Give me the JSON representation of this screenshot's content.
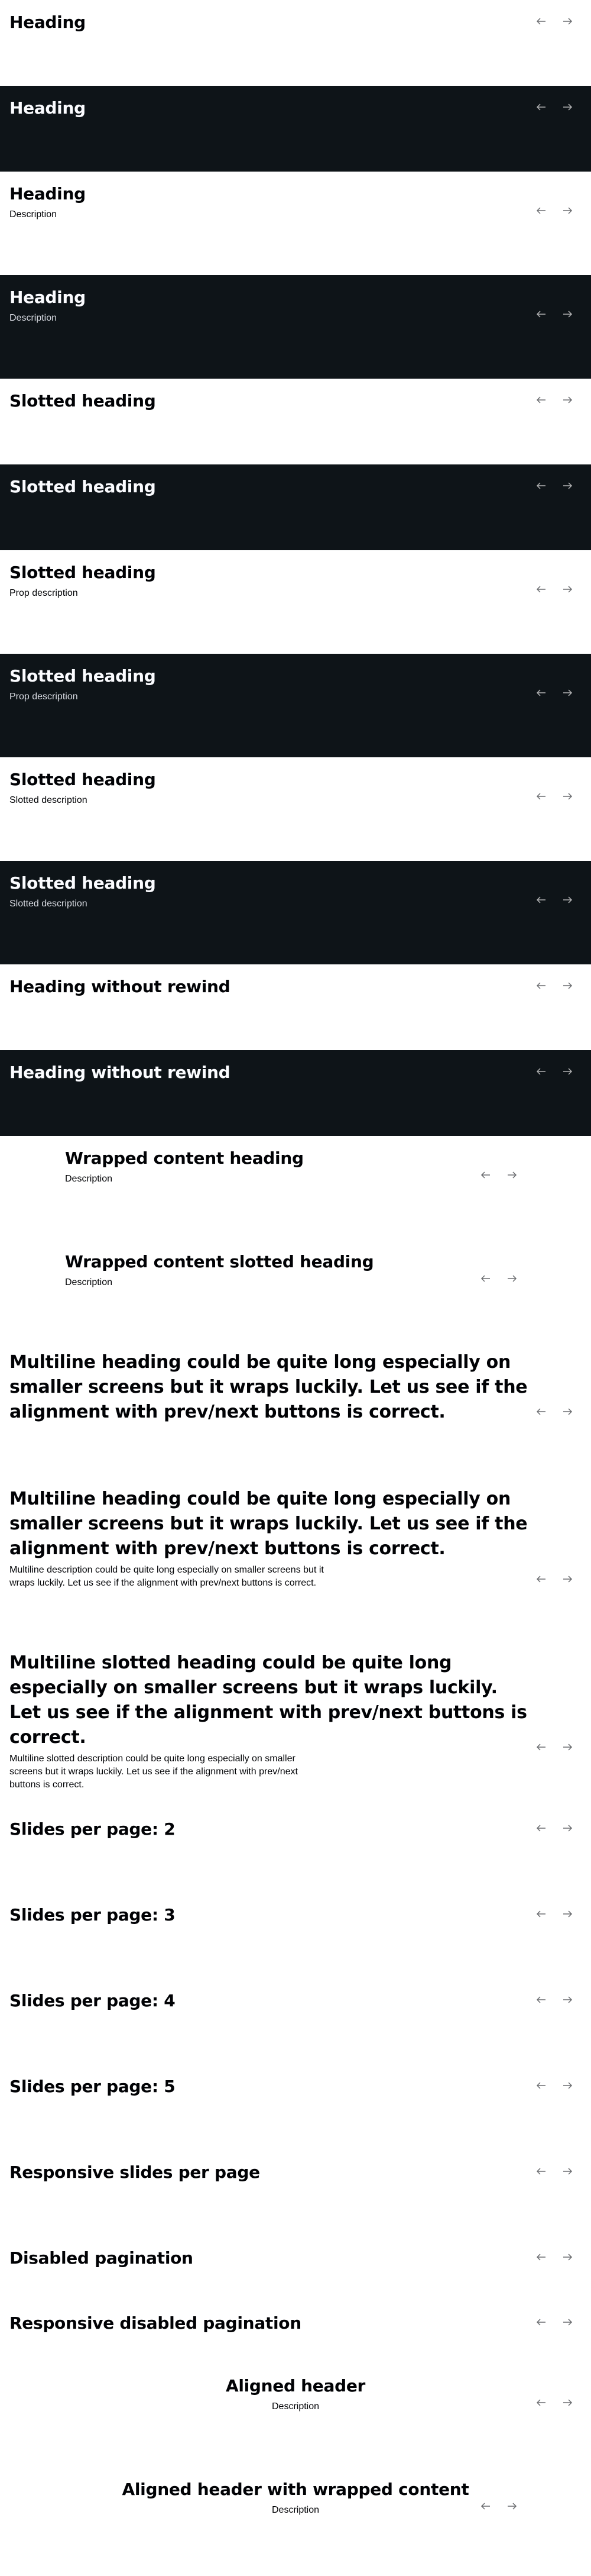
{
  "sections": [
    {
      "heading": "Heading",
      "description": ""
    },
    {
      "heading": "Heading",
      "description": ""
    },
    {
      "heading": "Heading",
      "description": "Description"
    },
    {
      "heading": "Heading",
      "description": "Description"
    },
    {
      "heading": "Slotted heading",
      "description": ""
    },
    {
      "heading": "Slotted heading",
      "description": ""
    },
    {
      "heading": "Slotted heading",
      "description": "Prop description"
    },
    {
      "heading": "Slotted heading",
      "description": "Prop description"
    },
    {
      "heading": "Slotted heading",
      "description": "Slotted description"
    },
    {
      "heading": "Slotted heading",
      "description": "Slotted description"
    },
    {
      "heading": "Heading without rewind",
      "description": ""
    },
    {
      "heading": "Heading without rewind",
      "description": ""
    },
    {
      "heading": "Wrapped content heading",
      "description": "Description"
    },
    {
      "heading": "Wrapped content slotted heading",
      "description": "Description"
    },
    {
      "heading": "Multiline heading could be quite long especially on smaller screens but it wraps luckily. Let us see if the alignment with prev/next buttons is correct.",
      "description": ""
    },
    {
      "heading": "Multiline heading could be quite long especially on smaller screens but it wraps luckily. Let us see if the alignment with prev/next buttons is correct.",
      "description": "Multiline description could be quite long especially on smaller screens but it wraps luckily. Let us see if the alignment with prev/next buttons is correct."
    },
    {
      "heading": "Multiline slotted heading could be quite long especially on smaller screens but it wraps luckily. Let us see if the alignment with prev/next buttons is correct.",
      "description": "Multiline slotted description could be quite long especially on smaller screens but it wraps luckily. Let us see if the alignment with prev/next buttons is correct."
    },
    {
      "heading": "Slides per page: 2",
      "description": ""
    },
    {
      "heading": "Slides per page: 3",
      "description": ""
    },
    {
      "heading": "Slides per page: 4",
      "description": ""
    },
    {
      "heading": "Slides per page: 5",
      "description": ""
    },
    {
      "heading": "Responsive slides per page",
      "description": ""
    },
    {
      "heading": "Disabled pagination",
      "description": ""
    },
    {
      "heading": "Responsive disabled pagination",
      "description": ""
    },
    {
      "heading": "Aligned header",
      "description": "Description"
    },
    {
      "heading": "Aligned header with wrapped content",
      "description": "Description"
    }
  ],
  "icons": {
    "prev": "arrow-left-icon",
    "next": "arrow-right-icon"
  },
  "colors": {
    "dark_background": "#0e1418",
    "light_background": "#ffffff",
    "dark_text": "#010205",
    "light_text": "#fbfcff"
  }
}
